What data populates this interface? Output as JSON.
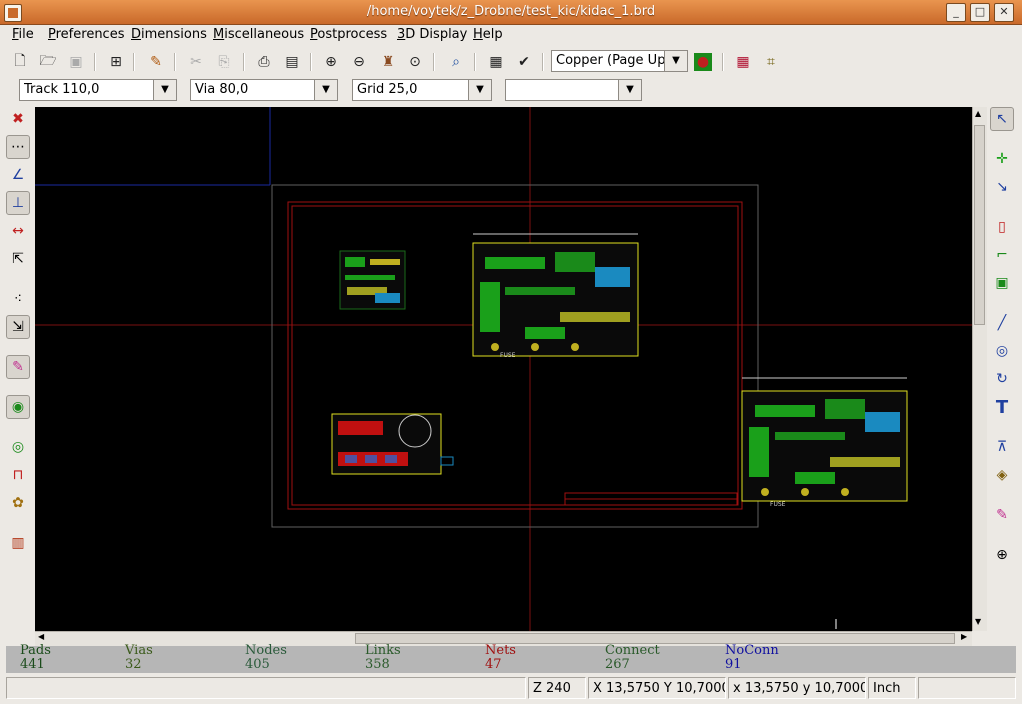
{
  "window": {
    "title": "/home/voytek/z_Drobne/test_kic/kidac_1.brd"
  },
  "menu": [
    {
      "pre": "",
      "u": "F",
      "post": "ile"
    },
    {
      "pre": "",
      "u": "P",
      "post": "references"
    },
    {
      "pre": "",
      "u": "D",
      "post": "imensions"
    },
    {
      "pre": "",
      "u": "M",
      "post": "iscellaneous"
    },
    {
      "pre": "",
      "u": "P",
      "post": "ostprocess"
    },
    {
      "pre": "",
      "u": "3",
      "post": "D Display"
    },
    {
      "pre": "",
      "u": "H",
      "post": "elp"
    }
  ],
  "toolbar": {
    "layer_select": "Copper    (Page Up)",
    "track": "Track 110,0",
    "via": "Via 80,0",
    "grid": "Grid 25,0",
    "zoom": ""
  },
  "stats": [
    {
      "label": "Pads",
      "value": "441",
      "color": "#1a4b1a"
    },
    {
      "label": "Vias",
      "value": "32",
      "color": "#3a5a1a"
    },
    {
      "label": "Nodes",
      "value": "405",
      "color": "#2a5a3a"
    },
    {
      "label": "Links",
      "value": "358",
      "color": "#2a5a2a"
    },
    {
      "label": "Nets",
      "value": "47",
      "color": "#a01010"
    },
    {
      "label": "Connect",
      "value": "267",
      "color": "#2a5a2a"
    },
    {
      "label": "NoConn",
      "value": "91",
      "color": "#1010a0"
    }
  ],
  "status": {
    "zoom": "Z 240",
    "abs": "X 13,5750  Y 10,7000",
    "rel": "x 13,5750  y 10,7000",
    "units": "Inch"
  },
  "board": {
    "silk_text_1": "FUSE",
    "silk_text_2": "FUSE"
  }
}
